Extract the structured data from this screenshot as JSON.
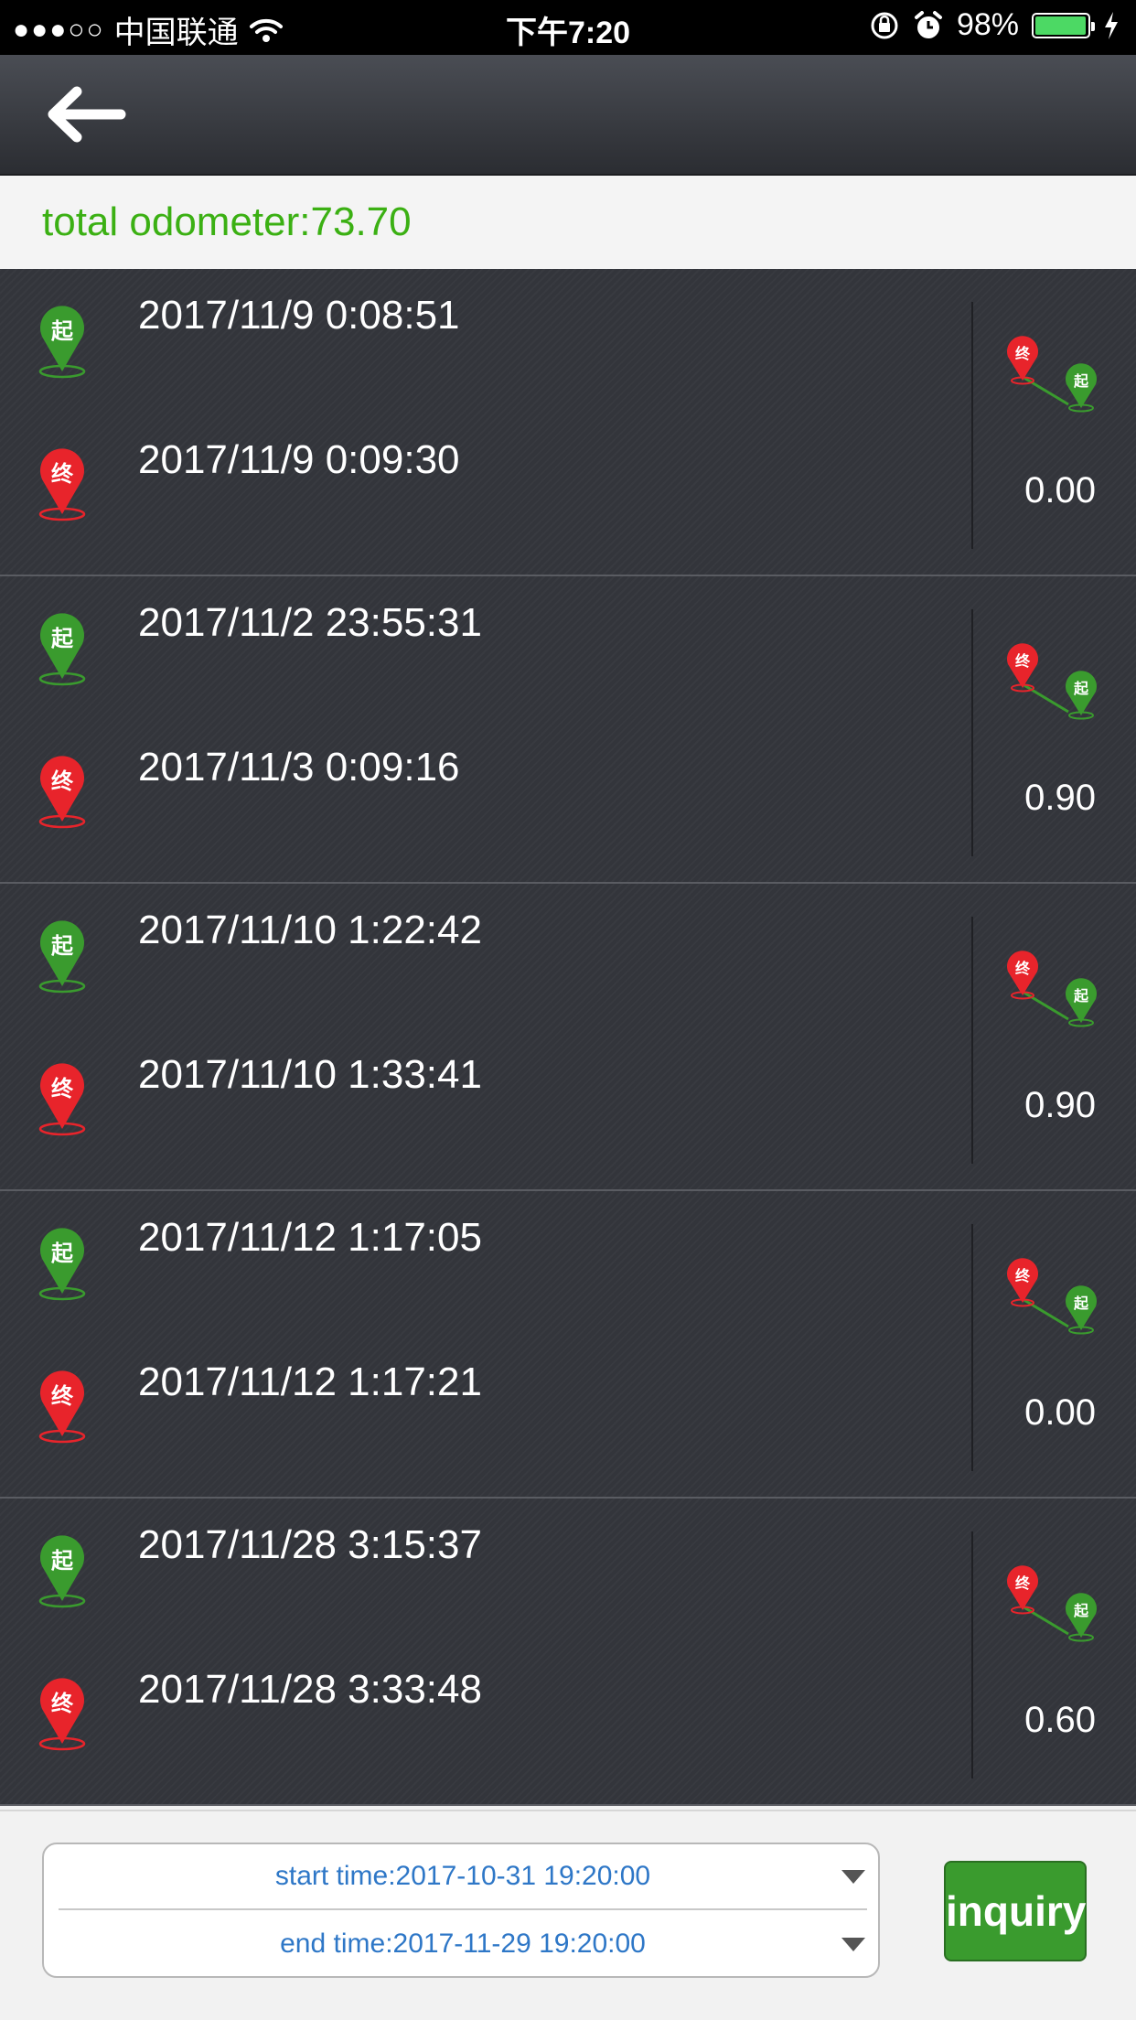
{
  "status_bar": {
    "signal": "●●●○○",
    "carrier": "中国联通",
    "time": "下午7:20",
    "battery": "98%",
    "battery_level": 0.98
  },
  "nav": {
    "back_icon": "arrow-left-icon"
  },
  "odometer": {
    "label": "total odometer:",
    "value": "73.70"
  },
  "colors": {
    "accent_green": "#3bb013",
    "start_pin": "#3a9b2e",
    "end_pin": "#e8242b",
    "link_blue": "#2e77c7"
  },
  "pins": {
    "start_char": "起",
    "end_char": "终"
  },
  "trips": [
    {
      "start": "2017/11/9 0:08:51",
      "end": "2017/11/9 0:09:30",
      "distance": "0.00"
    },
    {
      "start": "2017/11/2 23:55:31",
      "end": "2017/11/3 0:09:16",
      "distance": "0.90"
    },
    {
      "start": "2017/11/10 1:22:42",
      "end": "2017/11/10 1:33:41",
      "distance": "0.90"
    },
    {
      "start": "2017/11/12 1:17:05",
      "end": "2017/11/12 1:17:21",
      "distance": "0.00"
    },
    {
      "start": "2017/11/28 3:15:37",
      "end": "2017/11/28 3:33:48",
      "distance": "0.60"
    }
  ],
  "query": {
    "start_time": "start time:2017-10-31 19:20:00",
    "end_time": "end time:2017-11-29 19:20:00",
    "inquiry_label": "inquiry"
  }
}
